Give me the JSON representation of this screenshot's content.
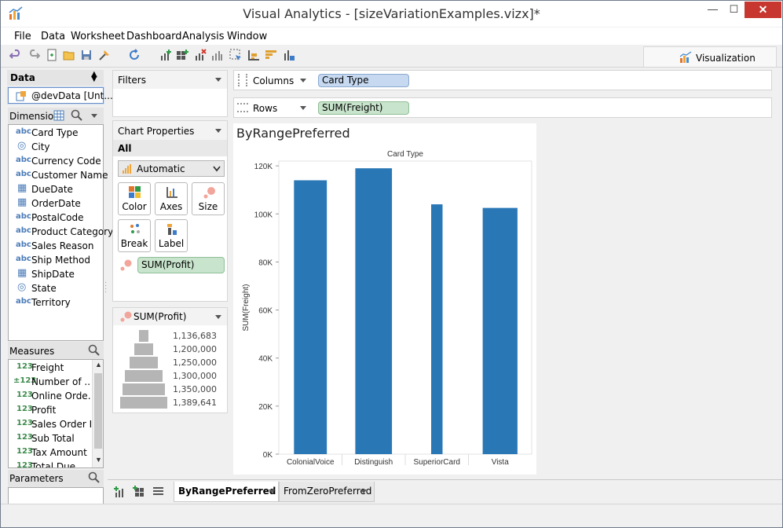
{
  "window": {
    "title": "Visual Analytics - [sizeVariationExamples.vizx]*",
    "minimize": "—",
    "maximize": "☐",
    "close": "✕"
  },
  "menu": [
    "File",
    "Data",
    "Worksheet",
    "Dashboard",
    "Analysis",
    "Window"
  ],
  "toolbar": {
    "icons": [
      "undo-icon",
      "redo-icon",
      "new-icon",
      "open-icon",
      "save-icon",
      "format-icon",
      "refresh-icon",
      "new-worksheet-icon",
      "new-dashboard-icon",
      "clear-sheet-icon",
      "duplicate-sheet-icon",
      "select-icon",
      "sort-asc-icon",
      "sort-desc-icon",
      "fit-icon"
    ],
    "visualization_tab": "Visualization"
  },
  "data_panel": {
    "header": "Data",
    "datasource": "@devData [Unt...",
    "dimensions_label": "Dimensions",
    "dimensions": [
      {
        "type": "abc",
        "name": "Card Type"
      },
      {
        "type": "geo",
        "name": "City"
      },
      {
        "type": "abc",
        "name": "Currency Code"
      },
      {
        "type": "abc",
        "name": "Customer Name"
      },
      {
        "type": "date",
        "name": "DueDate"
      },
      {
        "type": "date",
        "name": "OrderDate"
      },
      {
        "type": "abc",
        "name": "PostalCode"
      },
      {
        "type": "abc",
        "name": "Product Category"
      },
      {
        "type": "abc",
        "name": "Sales Reason"
      },
      {
        "type": "abc",
        "name": "Ship Method"
      },
      {
        "type": "date",
        "name": "ShipDate"
      },
      {
        "type": "geo",
        "name": "State"
      },
      {
        "type": "abc",
        "name": "Territory"
      }
    ],
    "measures_label": "Measures",
    "measures": [
      {
        "type": "123",
        "name": "Freight"
      },
      {
        "type": "calc123",
        "name": "Number of ..."
      },
      {
        "type": "123",
        "name": "Online Orde..."
      },
      {
        "type": "123",
        "name": "Profit"
      },
      {
        "type": "123",
        "name": "Sales Order ID"
      },
      {
        "type": "123",
        "name": "Sub Total"
      },
      {
        "type": "123",
        "name": "Tax Amount"
      },
      {
        "type": "123",
        "name": "Total Due"
      }
    ],
    "parameters_label": "Parameters"
  },
  "filters": {
    "label": "Filters"
  },
  "chart_properties": {
    "label": "Chart Properties",
    "scope": "All",
    "mark_type": "Automatic",
    "buttons": [
      "Color",
      "Axes",
      "Size",
      "Break",
      "Label"
    ],
    "size_pill": "SUM(Profit)"
  },
  "size_legend": {
    "title": "SUM(Profit)",
    "entries": [
      "1,136,683",
      "1,200,000",
      "1,250,000",
      "1,300,000",
      "1,350,000",
      "1,389,641"
    ]
  },
  "shelves": {
    "columns_label": "Columns",
    "columns_pill": "Card Type",
    "rows_label": "Rows",
    "rows_pill": "SUM(Freight)"
  },
  "chart_data": {
    "type": "bar",
    "title": "ByRangePreferred",
    "xlabel": "Card Type",
    "ylabel": "SUM(Freight)",
    "categories": [
      "ColonialVoice",
      "Distinguish",
      "SuperiorCard",
      "Vista"
    ],
    "values": [
      114000,
      119000,
      104000,
      102500
    ],
    "bar_width_by_size": [
      0.52,
      0.58,
      0.18,
      0.55
    ],
    "ylim": [
      0,
      122000
    ],
    "yticks": [
      0,
      20000,
      40000,
      60000,
      80000,
      100000,
      120000
    ],
    "ytick_labels": [
      "0K",
      "20K",
      "40K",
      "60K",
      "80K",
      "100K",
      "120K"
    ],
    "color": "#2a77b6",
    "grid": false
  },
  "sheets": {
    "tabs": [
      "ByRangePreferred",
      "FromZeroPreferred"
    ],
    "active": "ByRangePreferred"
  }
}
